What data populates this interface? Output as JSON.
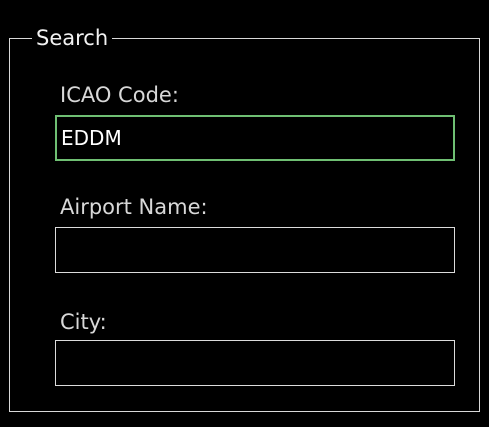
{
  "search_group": {
    "title": "Search",
    "icao": {
      "label": "ICAO Code:",
      "value": "EDDM"
    },
    "airport_name": {
      "label": "Airport Name:",
      "value": ""
    },
    "city": {
      "label": "City:",
      "value": ""
    }
  },
  "colors": {
    "background": "#000000",
    "frame": "#d9d9d9",
    "focused_input_border": "#6fbf73"
  }
}
